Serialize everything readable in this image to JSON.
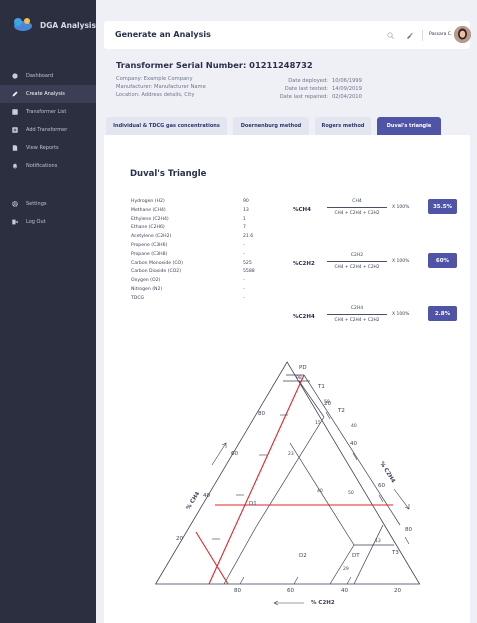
{
  "app": {
    "brand": "DGA Analysis"
  },
  "sidebar": {
    "items": [
      {
        "label": "Dashboard",
        "icon": "dashboard-icon"
      },
      {
        "label": "Create Analysis",
        "icon": "edit-icon"
      },
      {
        "label": "Transformer List",
        "icon": "list-icon"
      },
      {
        "label": "Add Transformer",
        "icon": "plus-icon"
      },
      {
        "label": "View Reports",
        "icon": "document-icon"
      },
      {
        "label": "Notifications",
        "icon": "bell-icon"
      },
      {
        "label": "Settings",
        "icon": "gear-icon"
      },
      {
        "label": "Log Out",
        "icon": "logout-icon"
      }
    ]
  },
  "header": {
    "title": "Generate an Analysis",
    "user_name": "Passara C."
  },
  "transformer": {
    "serial_label": "Transformer Serial Number:",
    "serial_number": "01211248732",
    "company": "Company: Example Company",
    "manufacturer": "Manufacturer: Manufacturer Name",
    "location": "Location: Address details, City",
    "dates": [
      {
        "label": "Date deployed:",
        "value": "10/06/1999"
      },
      {
        "label": "Date last tested:",
        "value": "14/09/2019"
      },
      {
        "label": "Date last repaired:",
        "value": "02/04/2010"
      }
    ]
  },
  "tabs": [
    {
      "label": "Individual & TDCG gas concentrations"
    },
    {
      "label": "Doernenburg method"
    },
    {
      "label": "Rogers method"
    },
    {
      "label": "Duval's triangle"
    }
  ],
  "duval": {
    "title": "Duval's Triangle",
    "gases": [
      {
        "name": "Hydrogen (H2)",
        "value": "90"
      },
      {
        "name": "Methane (CH4)",
        "value": "13"
      },
      {
        "name": "Ethylene (C2H4)",
        "value": "1"
      },
      {
        "name": "Ethane (C2H6)",
        "value": "7"
      },
      {
        "name": "Acetylene (C2H2)",
        "value": "21.6"
      },
      {
        "name": "Propene (C3H6)",
        "value": "-"
      },
      {
        "name": "Propane (C3H8)",
        "value": "-"
      },
      {
        "name": "Carbon Monoxide (CO)",
        "value": "525"
      },
      {
        "name": "Carbon Dioxide (CO2)",
        "value": "5588"
      },
      {
        "name": "Oxygen (O2)",
        "value": "-"
      },
      {
        "name": "Nitrogen (N2)",
        "value": "-"
      },
      {
        "name": "TDCG",
        "value": "-"
      }
    ],
    "formulas": [
      {
        "label": "%CH4",
        "numerator": "CH4",
        "denominator": "CH4 + C2H4 + C2H2",
        "multiplier": "X 100%",
        "result": "35.5%"
      },
      {
        "label": "%C2H2",
        "numerator": "C2H2",
        "denominator": "CH4 + C2H4 + C2H2",
        "multiplier": "X 100%",
        "result": "60%"
      },
      {
        "label": "%C2H4",
        "numerator": "C2H4",
        "denominator": "CH4 + C2H4 + C2H2",
        "multiplier": "X 100%",
        "result": "2.8%"
      }
    ],
    "triangle": {
      "zones": [
        "PD",
        "T1",
        "T2",
        "T3",
        "D1",
        "D2",
        "DT"
      ],
      "axis_ch4": "% CH4",
      "axis_c2h4": "% C2H4",
      "axis_c2h2": "% C2H2",
      "left_ticks": [
        "20",
        "40",
        "60",
        "80"
      ],
      "right_ticks": [
        "20",
        "40",
        "60",
        "80"
      ],
      "bottom_ticks": [
        "80",
        "60",
        "40",
        "20"
      ],
      "inner_labels": [
        "98",
        "50",
        "15",
        "23",
        "40",
        "50",
        "29",
        "13",
        "40"
      ],
      "accent_color": "#e0262a"
    }
  },
  "colors": {
    "accent": "#4f54a6",
    "sidebar": "#2b2f40",
    "highlight": "#e0262a"
  }
}
